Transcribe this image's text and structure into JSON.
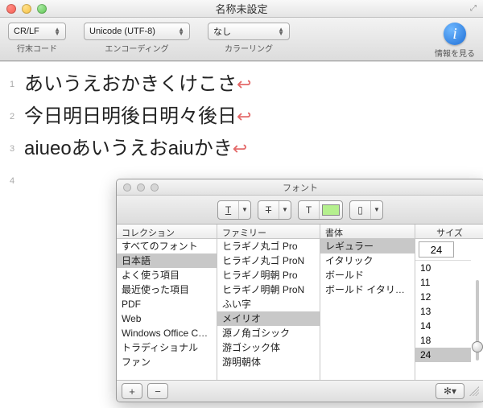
{
  "window": {
    "title": "名称未設定"
  },
  "toolbar": {
    "line_endings": {
      "value": "CR/LF",
      "label": "行末コード"
    },
    "encoding": {
      "value": "Unicode (UTF-8)",
      "label": "エンコーディング"
    },
    "coloring": {
      "value": "なし",
      "label": "カラーリング"
    },
    "info": {
      "label": "情報を見る",
      "icon_text": "i"
    }
  },
  "editor": {
    "lines": [
      {
        "n": "1",
        "text": "あいうえおかきくけこさ"
      },
      {
        "n": "2",
        "text": "今日明日明後日明々後日"
      },
      {
        "n": "3",
        "text": "aiueoあいうえおaiuかき"
      },
      {
        "n": "4",
        "text": ""
      }
    ],
    "return_glyph": "↩"
  },
  "font_panel": {
    "title": "フォント",
    "headers": {
      "collection": "コレクション",
      "family": "ファミリー",
      "face": "書体",
      "size": "サイズ"
    },
    "collections": [
      "すべてのフォント",
      "日本語",
      "よく使う項目",
      "最近使った項目",
      "PDF",
      "Web",
      "Windows Office Comp",
      "トラディショナル",
      "ファン"
    ],
    "collections_selected_index": 1,
    "families": [
      "ヒラギノ丸ゴ Pro",
      "ヒラギノ丸ゴ ProN",
      "ヒラギノ明朝 Pro",
      "ヒラギノ明朝 ProN",
      "ふい字",
      "メイリオ",
      "源ノ角ゴシック",
      "游ゴシック体",
      "游明朝体"
    ],
    "families_selected_index": 5,
    "faces": [
      "レギュラー",
      "イタリック",
      "ボールド",
      "ボールド イタリック"
    ],
    "faces_selected_index": 0,
    "size_value": "24",
    "sizes": [
      "10",
      "11",
      "12",
      "13",
      "14",
      "18",
      "24"
    ],
    "sizes_selected_index": 6,
    "toolbar": {
      "underline_label": "T",
      "strike_label": "T",
      "color_label": "T",
      "swatch_color": "#b5f08e",
      "doc_label": "▢"
    },
    "footer": {
      "add": "+",
      "remove": "−",
      "action": "✻▾"
    }
  }
}
